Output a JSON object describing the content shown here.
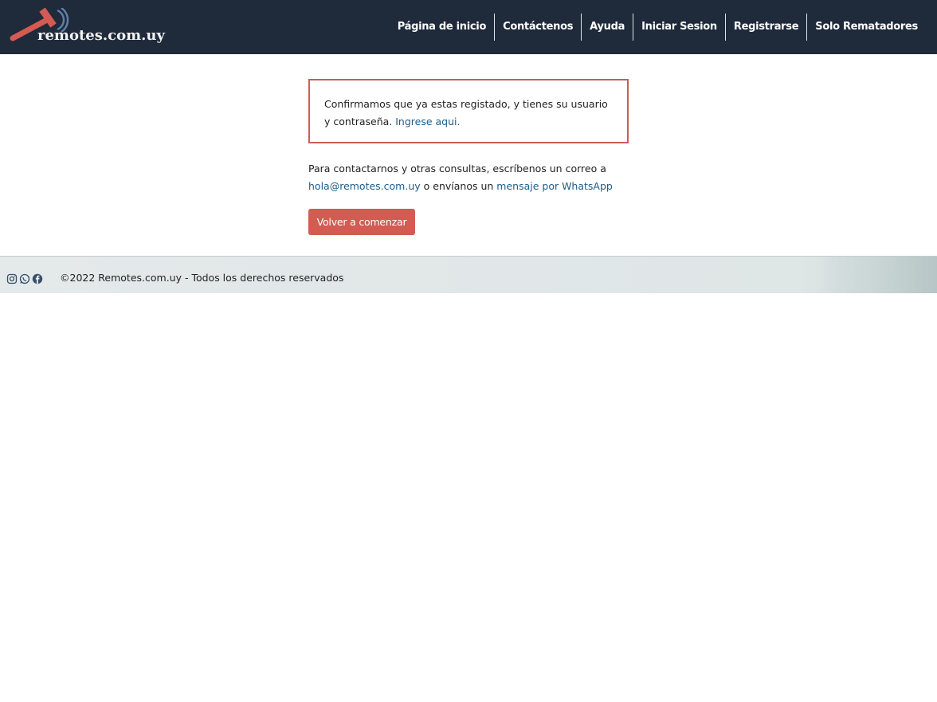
{
  "header": {
    "logo_text": "remotes.com.uy",
    "nav": [
      {
        "label": "Página de inicio",
        "name": "nav-home"
      },
      {
        "label": "Contáctenos",
        "name": "nav-contact"
      },
      {
        "label": "Ayuda",
        "name": "nav-help"
      },
      {
        "label": "Iniciar Sesion",
        "name": "nav-login"
      },
      {
        "label": "Registrarse",
        "name": "nav-register"
      },
      {
        "label": "Solo Rematadores",
        "name": "nav-auctioneers"
      }
    ]
  },
  "main": {
    "alert": {
      "text": "Confirmamos que ya estas registado, y tienes su usuario y contraseña. ",
      "link": "Ingrese aqui."
    },
    "contact": {
      "text_before": "Para contactarnos y otras consultas, escríbenos un correo a ",
      "email": "hola@remotes.com.uy",
      "text_middle": " o envíanos un ",
      "whatsapp": "mensaje por WhatsApp"
    },
    "restart_button": "Volver a comenzar"
  },
  "footer": {
    "icons": [
      "instagram-icon",
      "whatsapp-icon",
      "facebook-icon"
    ],
    "copyright": "©2022 Remotes.com.uy - Todos los derechos reservados"
  },
  "colors": {
    "navbar": "#1f2a3b",
    "accent": "#d35b52",
    "link": "#1d5d8a",
    "alert_border": "#cd5c57"
  }
}
